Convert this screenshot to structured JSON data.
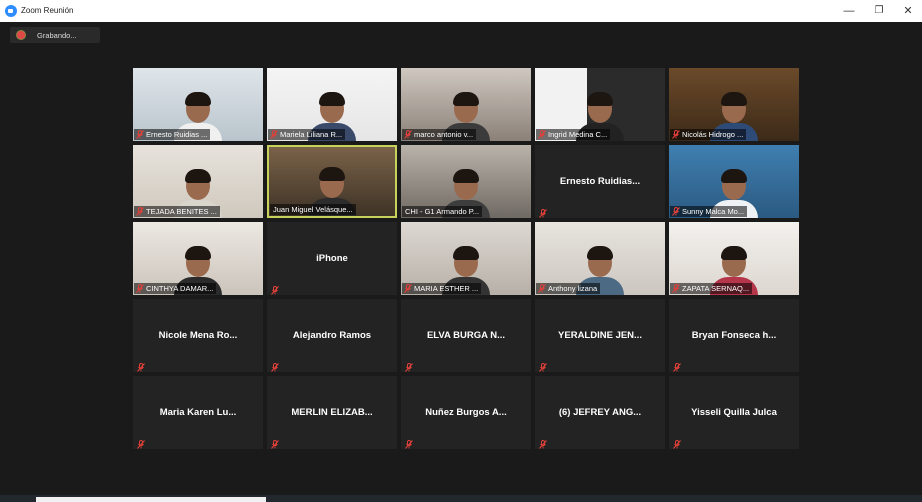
{
  "window": {
    "title": "Zoom Reunión",
    "minimize_icon": "minimize-icon",
    "maximize_icon": "restore-icon",
    "close_icon": "close-icon"
  },
  "recording": {
    "label": "Grabando..."
  },
  "colors": {
    "background": "#1a1a1a",
    "tile": "#232323",
    "active_speaker_border": "#c6d25a",
    "mic_muted": "#e0403a"
  },
  "participants": [
    {
      "name": "Ernesto Ruidias ...",
      "video": true,
      "muted": true
    },
    {
      "name": "Mariela Liliana R...",
      "video": true,
      "muted": true
    },
    {
      "name": "marco antonio v...",
      "video": true,
      "muted": true
    },
    {
      "name": "Ingrid Medina C...",
      "video": true,
      "muted": true
    },
    {
      "name": "Nicolás Hidrogo ...",
      "video": true,
      "muted": true
    },
    {
      "name": "TEJADA BENITES ...",
      "video": true,
      "muted": true
    },
    {
      "name": "Juan Miguel Velásque...",
      "video": true,
      "muted": false,
      "active": true
    },
    {
      "name": "CHI - G1 Armando P...",
      "video": true,
      "muted": false
    },
    {
      "name": "Ernesto Ruidias...",
      "video": false,
      "muted": true
    },
    {
      "name": "Sunny Malca Mo...",
      "video": true,
      "muted": true
    },
    {
      "name": "CINTHYA DAMAR...",
      "video": true,
      "muted": true
    },
    {
      "name": "iPhone",
      "video": false,
      "muted": true
    },
    {
      "name": "MARIA ESTHER ...",
      "video": true,
      "muted": true
    },
    {
      "name": "Anthony lizana",
      "video": true,
      "muted": true
    },
    {
      "name": "ZAPATA SERNAQ...",
      "video": true,
      "muted": true
    },
    {
      "name": "Nicole Mena Ro...",
      "video": false,
      "muted": true
    },
    {
      "name": "Alejandro Ramos",
      "video": false,
      "muted": true
    },
    {
      "name": "ELVA BURGA N...",
      "video": false,
      "muted": true
    },
    {
      "name": "YERALDINE JEN...",
      "video": false,
      "muted": true
    },
    {
      "name": "Bryan Fonseca h...",
      "video": false,
      "muted": true
    },
    {
      "name": "Maria Karen Lu...",
      "video": false,
      "muted": true
    },
    {
      "name": "MERLIN ELIZAB...",
      "video": false,
      "muted": true
    },
    {
      "name": "Nuñez Burgos A...",
      "video": false,
      "muted": true
    },
    {
      "name": "(6) JEFREY ANG...",
      "video": false,
      "muted": true
    },
    {
      "name": "Yisseli Quilla Julca",
      "video": false,
      "muted": true
    }
  ]
}
